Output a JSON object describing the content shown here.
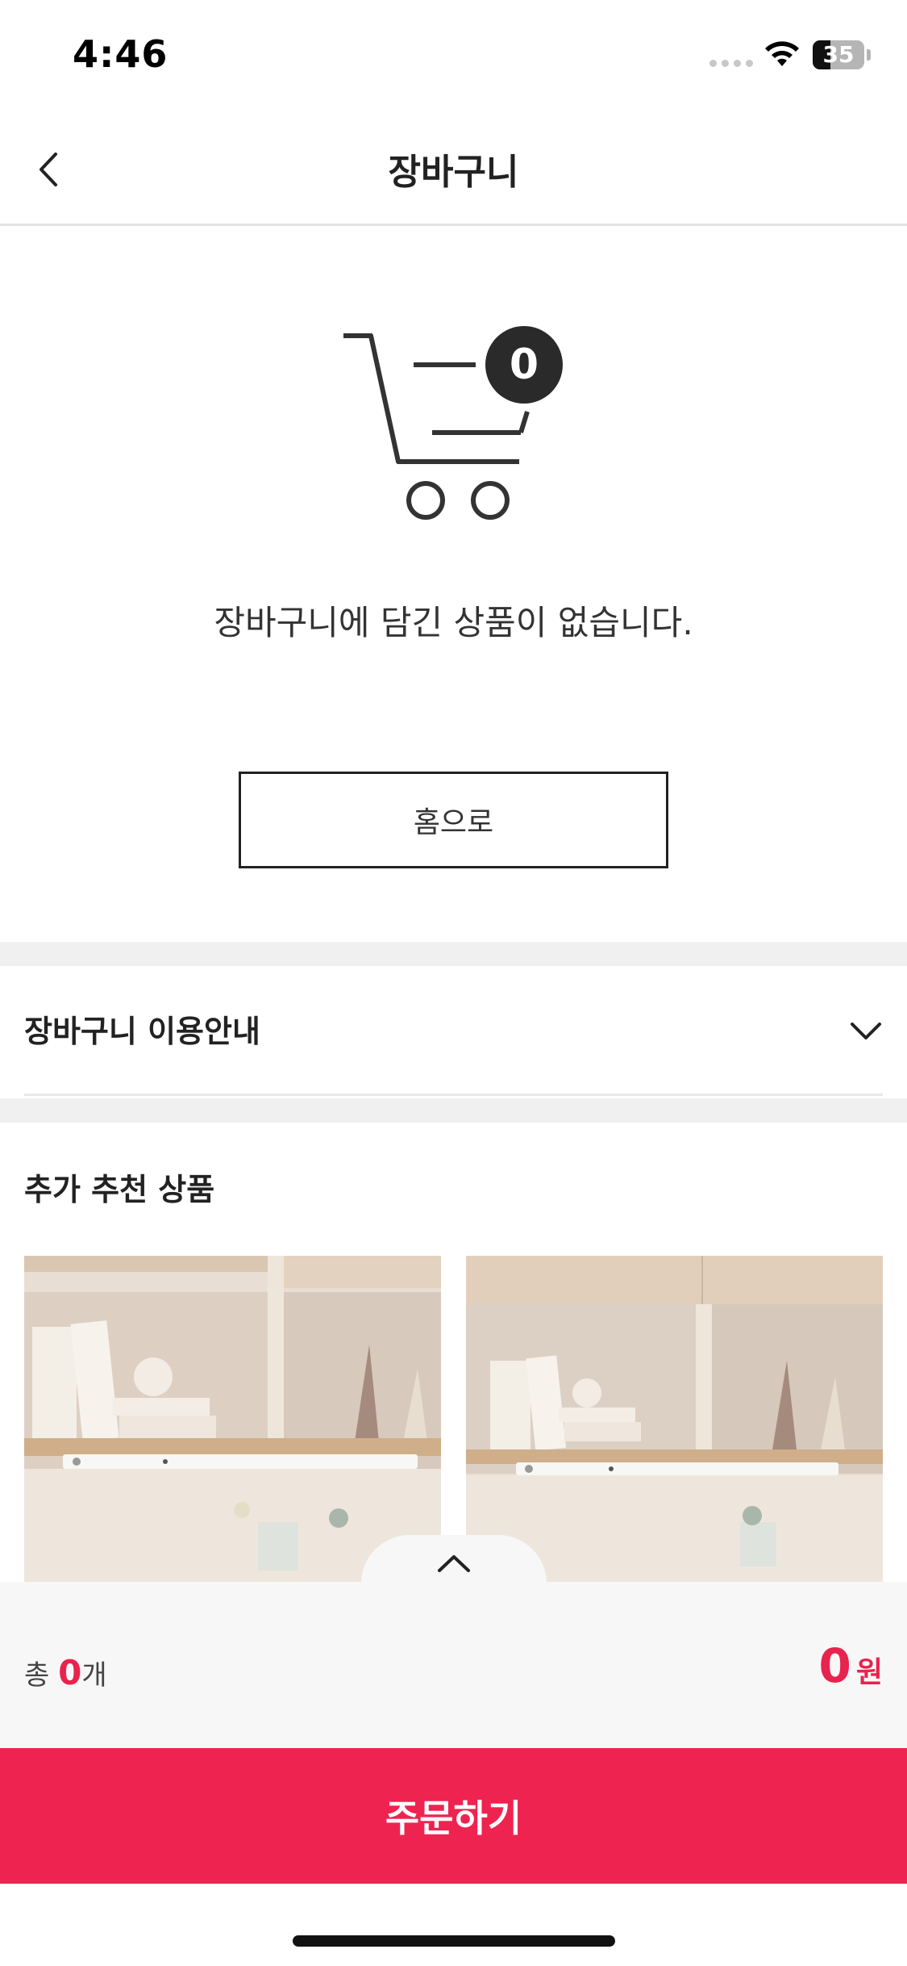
{
  "status_bar": {
    "time": "4:46",
    "battery": "35",
    "battery_level": 0.35
  },
  "header": {
    "title": "장바구니",
    "back_icon": "chevron-left-icon"
  },
  "empty_cart": {
    "badge_count": "0",
    "message": "장바구니에 담긴 상품이 없습니다.",
    "home_button": "홈으로"
  },
  "guide": {
    "title": "장바구니 이용안내",
    "icon": "chevron-down-icon"
  },
  "recommended": {
    "title": "추가 추천 상품"
  },
  "summary": {
    "count_prefix": "총",
    "count": "0",
    "count_suffix": "개",
    "price": "0",
    "currency": "원",
    "accent_color": "#ef2350"
  },
  "order_button": "주문하기"
}
